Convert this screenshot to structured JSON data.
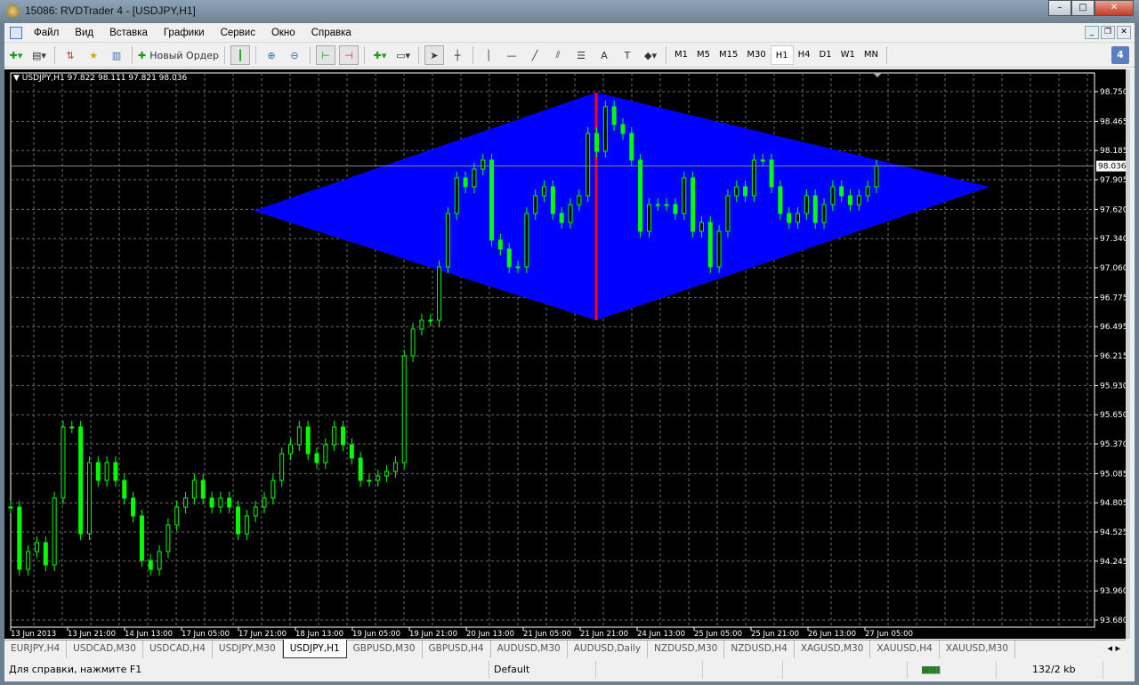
{
  "window": {
    "title": "15086: RVDTrader 4 - [USDJPY,H1]",
    "minimize": "–",
    "maximize": "□",
    "close": "✕"
  },
  "menu": [
    "Файл",
    "Вид",
    "Вставка",
    "Графики",
    "Сервис",
    "Окно",
    "Справка"
  ],
  "toolbar": {
    "new_order": "Новый Ордер",
    "timeframes": [
      "M1",
      "M5",
      "M15",
      "M30",
      "H1",
      "H4",
      "D1",
      "W1",
      "MN"
    ],
    "active_timeframe": "H1",
    "badge": "4",
    "text_tool": "A",
    "text_label_tool": "T"
  },
  "chart": {
    "header": "USDJPY,H1  97.822 98.111 97.821 98.036",
    "symbol": "USDJPY",
    "period": "H1",
    "ohlc": {
      "open": 97.822,
      "high": 98.111,
      "low": 97.821,
      "close": 98.036
    },
    "current_price": "98.036",
    "price_ticks": [
      "98.750",
      "98.465",
      "98.185",
      "97.905",
      "97.620",
      "97.340",
      "97.060",
      "96.775",
      "96.495",
      "96.215",
      "95.930",
      "95.650",
      "95.370",
      "95.085",
      "94.805",
      "94.525",
      "94.245",
      "93.960",
      "93.680"
    ],
    "time_labels": [
      "13 Jun 2013",
      "13 Jun 21:00",
      "14 Jun 13:00",
      "17 Jun 05:00",
      "17 Jun 21:00",
      "18 Jun 13:00",
      "19 Jun 05:00",
      "19 Jun 21:00",
      "20 Jun 13:00",
      "21 Jun 05:00",
      "21 Jun 21:00",
      "24 Jun 13:00",
      "25 Jun 05:00",
      "25 Jun 21:00",
      "26 Jun 13:00",
      "27 Jun 05:00"
    ],
    "colors": {
      "background": "#000000",
      "candles": "#00ff00",
      "grid": "#6b6b6b",
      "diamond": "#0000ff",
      "vline": "#ff0000",
      "axis_text": "#ffffff"
    },
    "closes": [
      94.764,
      94.167,
      94.337,
      94.423,
      94.209,
      94.85,
      95.532,
      95.532,
      94.508,
      95.191,
      95.02,
      95.191,
      95.02,
      94.85,
      94.679,
      94.252,
      94.167,
      94.337,
      94.593,
      94.764,
      94.85,
      95.02,
      94.85,
      94.764,
      94.85,
      94.764,
      94.508,
      94.679,
      94.764,
      94.85,
      95.02,
      95.276,
      95.362,
      95.532,
      95.276,
      95.191,
      95.362,
      95.532,
      95.362,
      95.234,
      95.02,
      95.02,
      95.063,
      95.106,
      95.191,
      96.215,
      96.471,
      96.557,
      96.557,
      97.069,
      97.581,
      97.922,
      97.837,
      98.007,
      98.093,
      97.325,
      97.239,
      97.069,
      97.069,
      97.581,
      97.751,
      97.837,
      97.581,
      97.495,
      97.666,
      97.751,
      98.349,
      98.178,
      98.605,
      98.434,
      98.349,
      98.093,
      97.41,
      97.666,
      97.666,
      97.666,
      97.581,
      97.922,
      97.41,
      97.495,
      97.069,
      97.41,
      97.751,
      97.837,
      97.751,
      98.093,
      98.093,
      97.837,
      97.581,
      97.495,
      97.581,
      97.751,
      97.495,
      97.666,
      97.837,
      97.751,
      97.666,
      97.751,
      97.837,
      98.036
    ]
  },
  "tabs": [
    "EURJPY,H4",
    "USDCAD,M30",
    "USDCAD,H4",
    "USDJPY,M30",
    "USDJPY,H1",
    "GBPUSD,M30",
    "GBPUSD,H4",
    "AUDUSD,M30",
    "AUDUSD,Daily",
    "NZDUSD,M30",
    "NZDUSD,H4",
    "XAGUSD,M30",
    "XAUUSD,H4",
    "XAUUSD,M30"
  ],
  "active_tab": "USDJPY,H1",
  "tab_nav": "◂ ▸",
  "status": {
    "help": "Для справки, нажмите F1",
    "profile": "Default",
    "traffic": "132/2 kb"
  }
}
